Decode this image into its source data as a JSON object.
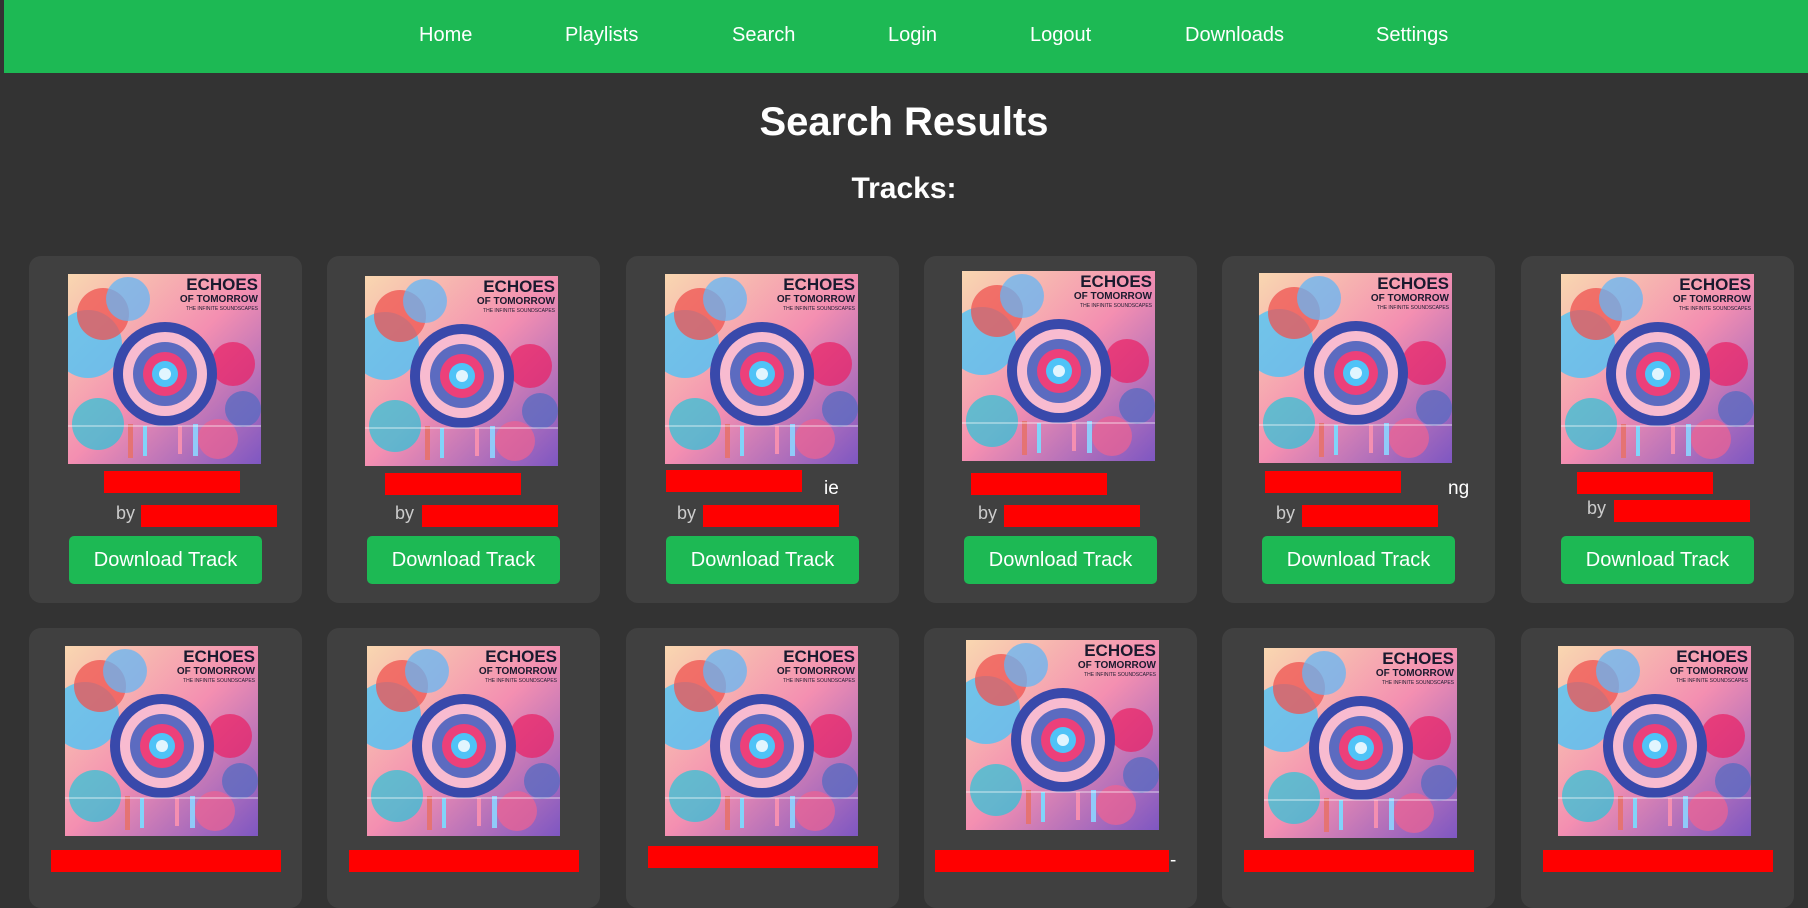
{
  "nav": {
    "items": [
      {
        "label": "Home"
      },
      {
        "label": "Playlists"
      },
      {
        "label": "Search"
      },
      {
        "label": "Login"
      },
      {
        "label": "Logout"
      },
      {
        "label": "Downloads"
      },
      {
        "label": "Settings"
      }
    ]
  },
  "page": {
    "title": "Search Results",
    "section_title": "Tracks:"
  },
  "colors": {
    "nav_bg": "#1db954",
    "page_bg": "#333333",
    "card_bg": "#404040",
    "button_bg": "#1db954",
    "redaction": "#ff0000"
  },
  "album_art": {
    "title_line1": "ECHOES",
    "title_line2": "OF TOMORROW",
    "subtitle": "THE INFINITE SOUNDSCAPES"
  },
  "tracks": [
    {
      "by": "by",
      "title_suffix": "",
      "button": "Download Track"
    },
    {
      "by": "by",
      "title_suffix": "",
      "button": "Download Track"
    },
    {
      "by": "by",
      "title_suffix": "ie",
      "button": "Download Track"
    },
    {
      "by": "by",
      "title_suffix": "",
      "button": "Download Track"
    },
    {
      "by": "by",
      "title_suffix": "ng",
      "button": "Download Track"
    },
    {
      "by": "by",
      "title_suffix": "",
      "button": "Download Track"
    },
    {
      "title_suffix": ""
    },
    {
      "title_suffix": ""
    },
    {
      "title_suffix": ""
    },
    {
      "title_suffix": "-"
    },
    {
      "title_suffix": ""
    },
    {
      "title_suffix": ""
    }
  ]
}
